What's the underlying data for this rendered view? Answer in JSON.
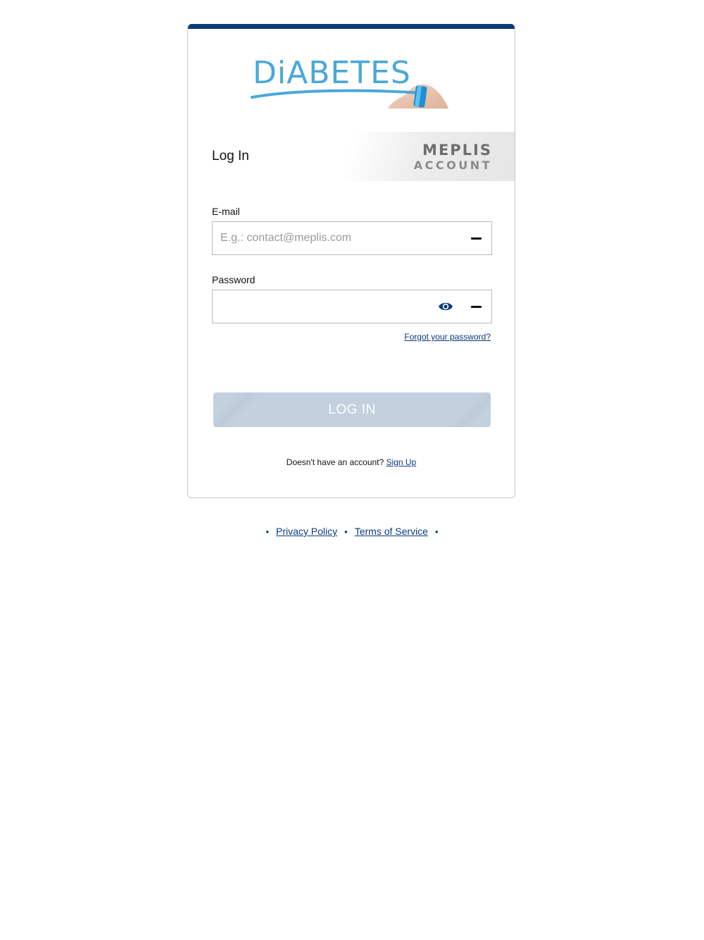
{
  "logo": {
    "text": "DiABETES"
  },
  "header": {
    "title": "Log In",
    "brand_top": "MEPLIS",
    "brand_bottom": "ACCOUNT"
  },
  "form": {
    "email_label": "E-mail",
    "email_placeholder": "E.g.: contact@meplis.com",
    "email_value": "",
    "password_label": "Password",
    "password_value": "",
    "forgot_link": "Forgot your password?",
    "login_button": "LOG IN"
  },
  "signup": {
    "prompt": "Doesn't have an account?",
    "link": "Sign Up"
  },
  "footer": {
    "privacy": "Privacy Policy",
    "terms": "Terms of Service",
    "separator": "•"
  },
  "colors": {
    "accent": "#0b3a7a",
    "button_disabled": "#c3d0de",
    "logo_blue": "#4aa8d8"
  },
  "icons": [
    "clear-icon",
    "eye-icon"
  ]
}
